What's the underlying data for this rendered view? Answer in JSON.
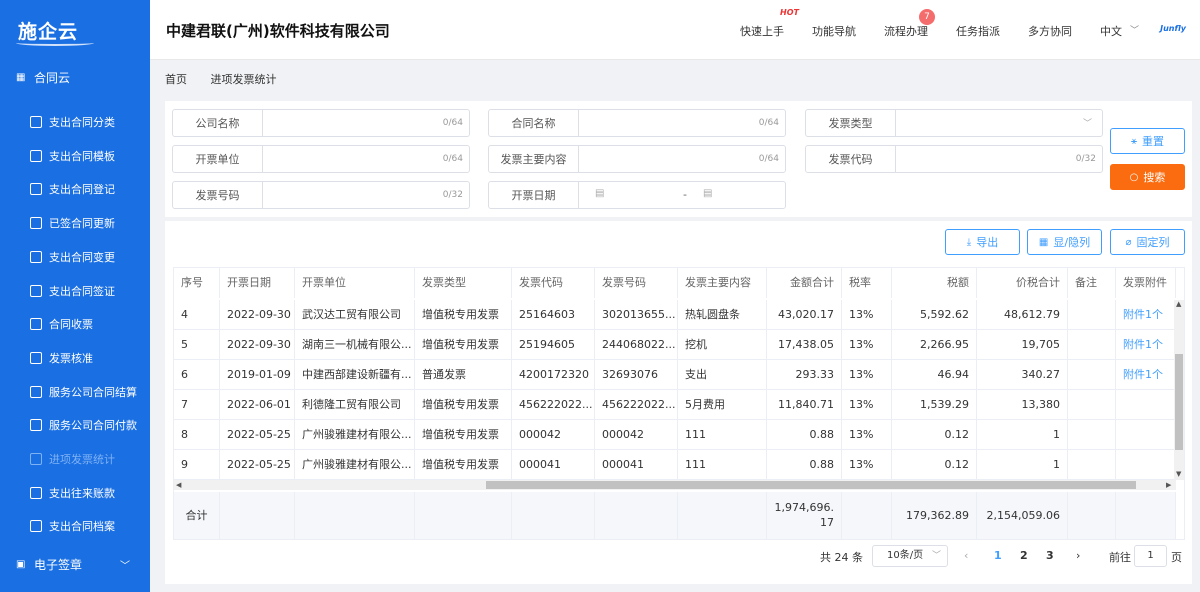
{
  "sidebar": {
    "logo": "施企云",
    "group": "合同云",
    "items": [
      {
        "label": "支出合同分类",
        "icon": "grid-icon"
      },
      {
        "label": "支出合同模板",
        "icon": "org-chart-icon"
      },
      {
        "label": "支出合同登记",
        "icon": "document-edit-icon"
      },
      {
        "label": "已签合同更新",
        "icon": "refresh-doc-icon"
      },
      {
        "label": "支出合同变更",
        "icon": "doc-change-icon"
      },
      {
        "label": "支出合同签证",
        "icon": "save-icon"
      },
      {
        "label": "合同收票",
        "icon": "home-icon"
      },
      {
        "label": "发票核准",
        "icon": "check-doc-icon"
      },
      {
        "label": "服务公司合同结算",
        "icon": "calculator-icon"
      },
      {
        "label": "服务公司合同付款",
        "icon": "yen-icon"
      },
      {
        "label": "进项发票统计",
        "icon": "chart-icon"
      },
      {
        "label": "支出往来账款",
        "icon": "ledger-icon"
      },
      {
        "label": "支出合同档案",
        "icon": "archive-icon"
      }
    ],
    "active_index": 10,
    "bottom": "电子签章"
  },
  "header": {
    "company": "中建君联(广州)软件科技有限公司",
    "nav": [
      "快速上手",
      "功能导航",
      "流程办理",
      "任务指派",
      "多方协同",
      "中文"
    ],
    "hot": "HOT",
    "badge": "7",
    "brand": "Junfly"
  },
  "breadcrumb": [
    "首页",
    "进项发票统计"
  ],
  "filters": [
    {
      "label": "公司名称",
      "count": "0/64"
    },
    {
      "label": "合同名称",
      "count": "0/64"
    },
    {
      "label": "发票类型",
      "count": ""
    },
    {
      "label": "开票单位",
      "count": "0/64"
    },
    {
      "label": "发票主要内容",
      "count": "0/64"
    },
    {
      "label": "发票代码",
      "count": "0/32"
    },
    {
      "label": "发票号码",
      "count": "0/32"
    },
    {
      "label": "开票日期",
      "count": ""
    }
  ],
  "date_separator": "-",
  "buttons": {
    "reset": "重置",
    "search": "搜索",
    "export": "导出",
    "toggle_cols": "显/隐列",
    "fix_cols": "固定列"
  },
  "table": {
    "headers": [
      "序号",
      "开票日期",
      "开票单位",
      "发票类型",
      "发票代码",
      "发票号码",
      "发票主要内容",
      "金额合计",
      "税率",
      "税额",
      "价税合计",
      "备注",
      "发票附件"
    ],
    "rows": [
      [
        "4",
        "2022-09-30",
        "武汉达工贸有限公司",
        "增值税专用发票",
        "25164603",
        "302013655...",
        "热轧圆盘条",
        "43,020.17",
        "13%",
        "5,592.62",
        "48,612.79",
        "",
        "附件1个"
      ],
      [
        "5",
        "2022-09-30",
        "湖南三一机械有限公...",
        "增值税专用发票",
        "25194605",
        "244068022...",
        "挖机",
        "17,438.05",
        "13%",
        "2,266.95",
        "19,705",
        "",
        "附件1个"
      ],
      [
        "6",
        "2019-01-09",
        "中建西部建设新疆有...",
        "普通发票",
        "4200172320",
        "32693076",
        "支出",
        "293.33",
        "13%",
        "46.94",
        "340.27",
        "",
        "附件1个"
      ],
      [
        "7",
        "2022-06-01",
        "利德隆工贸有限公司",
        "增值税专用发票",
        "456222022...",
        "456222022...",
        "5月费用",
        "11,840.71",
        "13%",
        "1,539.29",
        "13,380",
        "",
        ""
      ],
      [
        "8",
        "2022-05-25",
        "广州骏雅建材有限公...",
        "增值税专用发票",
        "000042",
        "000042",
        "111",
        "0.88",
        "13%",
        "0.12",
        "1",
        "",
        ""
      ],
      [
        "9",
        "2022-05-25",
        "广州骏雅建材有限公...",
        "增值税专用发票",
        "000041",
        "000041",
        "111",
        "0.88",
        "13%",
        "0.12",
        "1",
        "",
        ""
      ]
    ],
    "summary": {
      "label": "合计",
      "amount": "1,974,696.17",
      "tax": "179,362.89",
      "total": "2,154,059.06"
    }
  },
  "pagination": {
    "total": "共 24 条",
    "page_size": "10条/页",
    "pages": [
      "1",
      "2",
      "3"
    ],
    "current": "1",
    "goto_label": "前往",
    "goto_value": "1",
    "page_suffix": "页"
  }
}
